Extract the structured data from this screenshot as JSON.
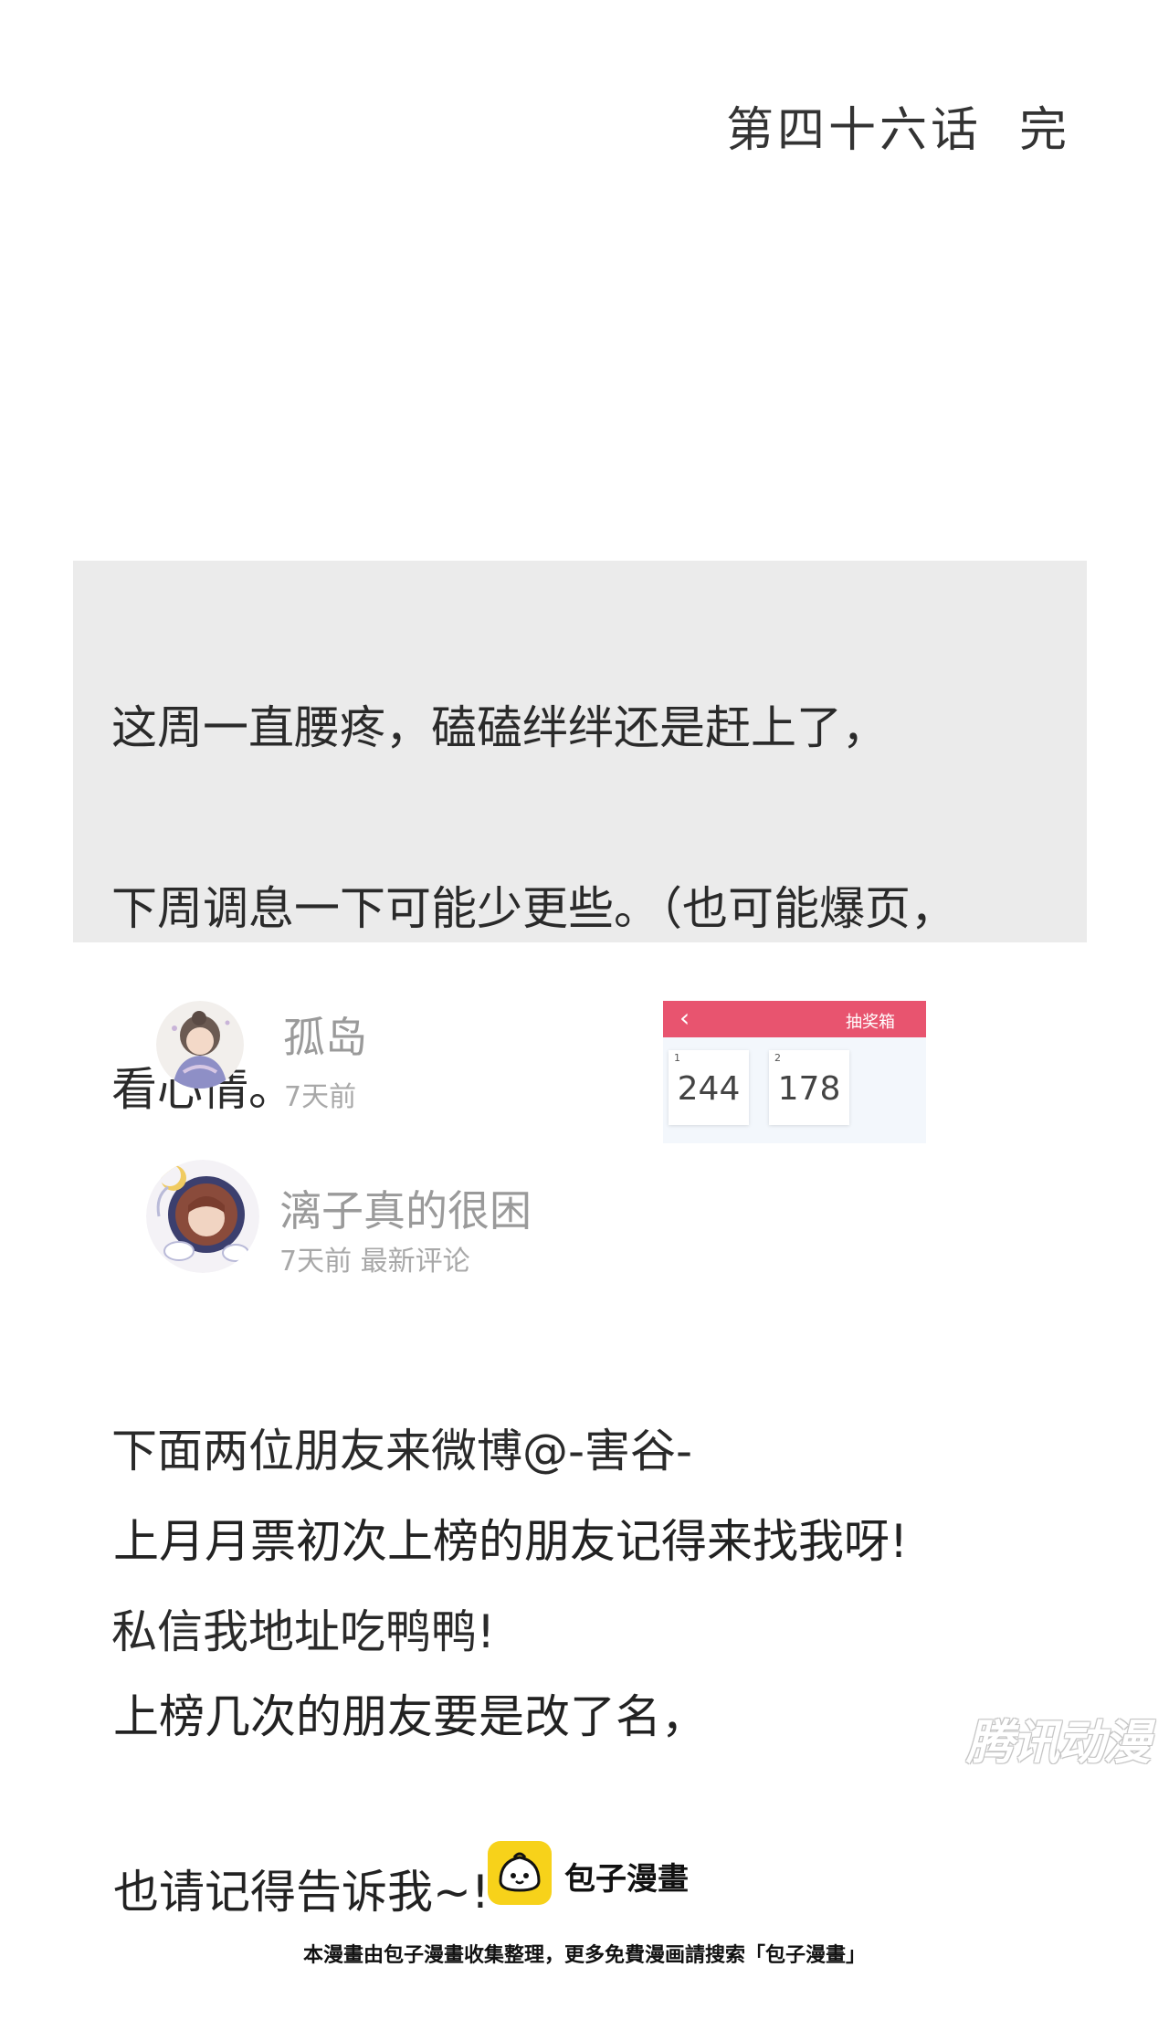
{
  "chapter_end": "第四十六话  完",
  "note": {
    "lines": [
      "这周一直腰疼，磕磕绊绊还是赶上了，",
      "下周调息一下可能少更些。（也可能爆页，",
      "看心情。",
      "",
      "下面两位朋友来微博@-害谷-",
      "私信我地址吃鸭鸭!"
    ]
  },
  "winners": [
    {
      "name": "孤岛",
      "meta": "7天前"
    },
    {
      "name": "漓子真的很困",
      "meta": "7天前 最新评论"
    }
  ],
  "lottery": {
    "back_icon": "chevron-left-icon",
    "title": "抽奖箱",
    "cards": [
      {
        "index": "1",
        "number": "244"
      },
      {
        "index": "2",
        "number": "178"
      }
    ],
    "colors": {
      "header": "#e8546f",
      "panel": "#f3f7fc"
    }
  },
  "closing": {
    "lines": [
      "上月月票初次上榜的朋友记得来找我呀!",
      "上榜几次的朋友要是改了名，",
      "也请记得告诉我~!"
    ]
  },
  "watermark": "腾讯动漫",
  "brand": {
    "logo_icon": "bun-face-logo",
    "name": "包子漫畫",
    "color": "#f7d21a"
  },
  "footer_note": "本漫畫由包子漫畫收集整理，更多免費漫画請搜索「包子漫畫」"
}
